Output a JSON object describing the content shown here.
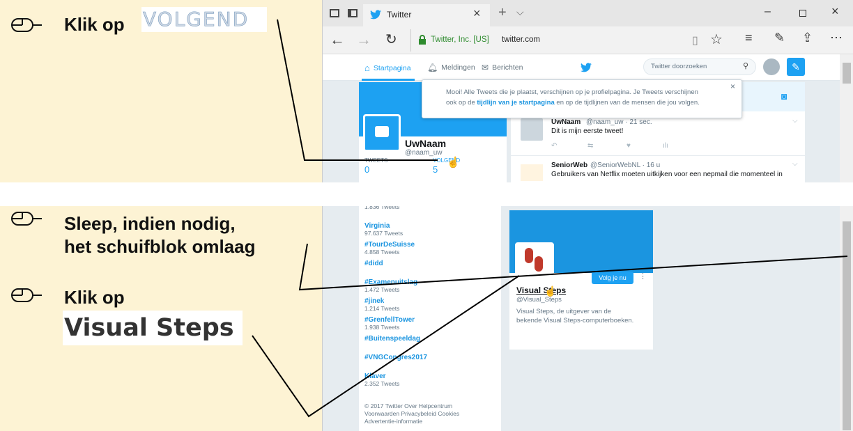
{
  "instructions": {
    "step1": {
      "prefix": "Klik op",
      "target_image_text": "VOLGEND"
    },
    "step2": {
      "line1": "Sleep, indien nodig,",
      "line2": "het schuifblok omlaag"
    },
    "step3": {
      "prefix": "Klik op",
      "target_image_text": "Visual Steps"
    }
  },
  "browser": {
    "tab_title": "Twitter",
    "address_owner": "Twitter, Inc. [US]",
    "address_url": "twitter.com",
    "window_controls": [
      "minimize-icon",
      "maximize-icon",
      "close-icon"
    ]
  },
  "twitter": {
    "nav": {
      "home": "Startpagina",
      "notifications": "Meldingen",
      "messages": "Berichten",
      "search_placeholder": "Twitter doorzoeken"
    },
    "toast": {
      "line1": "Mooi! Alle Tweets die je plaatst, verschijnen op je profielpagina. Je Tweets verschijnen",
      "line2_pre": "ook op de ",
      "line2_link": "tijdlijn van je startpagina",
      "line2_post": " en op de tijdlijnen van de mensen die jou volgen."
    },
    "profile": {
      "name": "UwNaam",
      "handle": "@naam_uw",
      "tweets_label": "TWEETS",
      "tweets_count": "0",
      "following_label": "VOLGEND",
      "following_count": "5"
    },
    "tweets": [
      {
        "name": "UwNaam",
        "meta": "@naam_uw · 21 sec.",
        "text": "Dit is mijn eerste tweet!"
      },
      {
        "name": "SeniorWeb",
        "meta": "@SeniorWebNL · 16 u",
        "text": "Gebruikers van Netflix moeten uitkijken voor een nepmail die momenteel in"
      }
    ],
    "trends": [
      {
        "name": "",
        "count": "1.836 Tweets"
      },
      {
        "name": "Virginia",
        "count": "97.637 Tweets"
      },
      {
        "name": "#TourDeSuisse",
        "count": "4.858 Tweets"
      },
      {
        "name": "#didd",
        "count": ""
      },
      {
        "name": "#Examenuitslag",
        "count": "1.472 Tweets"
      },
      {
        "name": "#jinek",
        "count": "1.214 Tweets"
      },
      {
        "name": "#GrenfellTower",
        "count": "1.938 Tweets"
      },
      {
        "name": "#Buitenspeeldag",
        "count": ""
      },
      {
        "name": "#VNGCongres2017",
        "count": ""
      },
      {
        "name": "Klaver",
        "count": "2.352 Tweets"
      }
    ],
    "footer": {
      "line1": "© 2017 Twitter  Over  Helpcentrum",
      "line2": "Voorwaarden  Privacybeleid  Cookies",
      "line3": "Advertentie-informatie"
    },
    "suggest": {
      "name": "Visual Steps",
      "handle": "@Visual_Steps",
      "bio_line1": "Visual Steps, de uitgever van de",
      "bio_line2": "bekende Visual Steps-computerboeken.",
      "follow_button": "Volg je nu"
    }
  },
  "colors": {
    "cream": "#fdf3d4",
    "twitter_blue": "#1da1f2",
    "link_blue": "#1b95e0",
    "secure_green": "#2e8b2e"
  }
}
